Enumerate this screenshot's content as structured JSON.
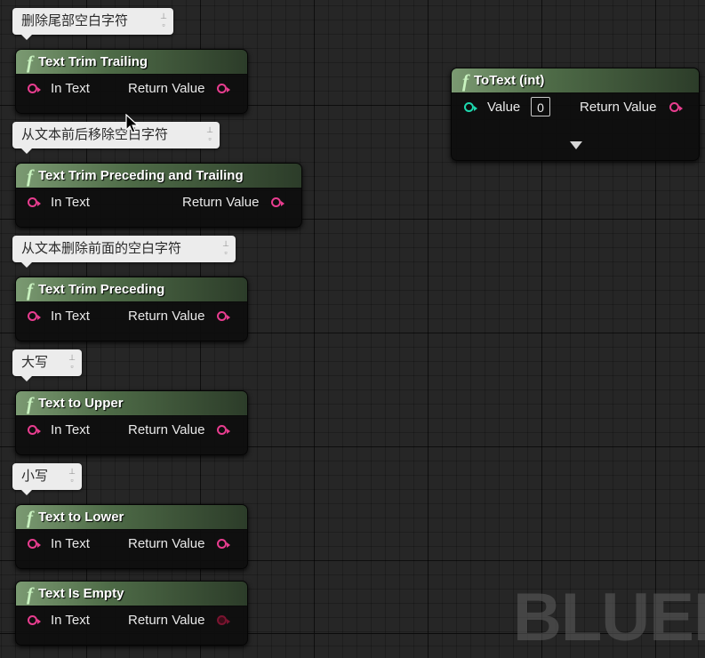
{
  "graph": {
    "watermark": "BLUEP"
  },
  "comments": [
    {
      "text": "删除尾部空白字符"
    },
    {
      "text": "从文本前后移除空白字符"
    },
    {
      "text": "从文本删除前面的空白字符"
    },
    {
      "text": "大写"
    },
    {
      "text": "小写"
    }
  ],
  "nodes": [
    {
      "icon": "function-icon",
      "title": "Text Trim Trailing",
      "input": "In Text",
      "output": "Return Value"
    },
    {
      "icon": "function-icon",
      "title": "Text Trim Preceding and Trailing",
      "input": "In Text",
      "output": "Return Value"
    },
    {
      "icon": "function-icon",
      "title": "Text Trim Preceding",
      "input": "In Text",
      "output": "Return Value"
    },
    {
      "icon": "function-icon",
      "title": "Text to Upper",
      "input": "In Text",
      "output": "Return Value"
    },
    {
      "icon": "function-icon",
      "title": "Text to Lower",
      "input": "In Text",
      "output": "Return Value"
    },
    {
      "icon": "function-icon",
      "title": "Text Is Empty",
      "input": "In Text",
      "output": "Return Value"
    },
    {
      "icon": "function-icon",
      "title": "ToText (int)",
      "input": "Value",
      "input_value": "0",
      "output": "Return Value"
    }
  ],
  "colors": {
    "text_pin": "#e83d8f",
    "int_pin": "#1dd8ae",
    "bool_pin": "#7a1430",
    "function_header": "#4e6b47"
  }
}
